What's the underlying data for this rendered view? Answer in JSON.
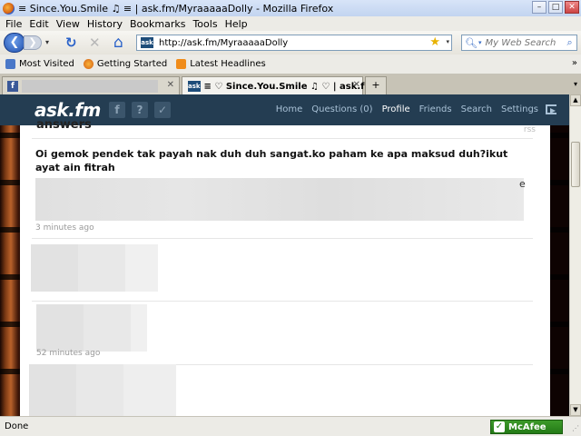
{
  "window": {
    "title": "≡ Since.You.Smile ♫ ≡ | ask.fm/MyraaaaaDolly - Mozilla Firefox",
    "minimize": "–",
    "maximize": "□",
    "close": "✕"
  },
  "menu": [
    "File",
    "Edit",
    "View",
    "History",
    "Bookmarks",
    "Tools",
    "Help"
  ],
  "nav": {
    "back": "❮",
    "forward": "❯",
    "dropdown": "▾",
    "reload": "↻",
    "stop": "✕",
    "home": "⌂",
    "url": "http://ask.fm/MyraaaaaDolly",
    "url_favicon": "ask",
    "star": "★",
    "search_placeholder": "My Web Search",
    "icons": {
      "back": "back-arrow-icon",
      "reload": "reload-icon",
      "stop": "stop-icon",
      "home": "home-icon",
      "bookmark": "star-icon",
      "search": "magnifier-icon"
    }
  },
  "bookmarks": [
    {
      "label": "Most Visited",
      "icon": "bookmark-folder-icon",
      "color": "#4a78c8"
    },
    {
      "label": "Getting Started",
      "icon": "firefox-icon",
      "color": "#e07b1a"
    },
    {
      "label": "Latest Headlines",
      "icon": "rss-icon",
      "color": "#f08c1a"
    }
  ],
  "bookmarks_overflow": "»",
  "tabs": [
    {
      "favicon": "f",
      "label": "",
      "close": "✕"
    },
    {
      "favicon": "ask",
      "label": "≡ ♡ Since.You.Smile ♫ ♡ | ask.fm/...",
      "close": "✕"
    }
  ],
  "new_tab": "+",
  "tab_list": "▾",
  "ask": {
    "logo": "ask.fm",
    "nav": [
      "Home",
      "Questions (0)",
      "Profile",
      "Friends",
      "Search",
      "Settings"
    ],
    "active_nav": "Profile",
    "colors": {
      "header": "#243d52",
      "nav_text": "#a9c1d6"
    }
  },
  "content": {
    "section_heading": "answers",
    "rss": "rss",
    "question": "Oi gemok pendek tak payah nak duh duh sangat.ko paham ke apa maksud duh?ikut ayat ain fitrah",
    "answer_edge_letter": "e",
    "time_ago": "3 minutes ago",
    "peek_time": "52 minutes ago"
  },
  "scrollbar": {
    "up": "▲",
    "down": "▼"
  },
  "status": {
    "text": "Done",
    "mcafee": "McAfee",
    "mcafee_check": "✓",
    "mcafee_color": "#2f8a20",
    "grip": "⋰"
  }
}
